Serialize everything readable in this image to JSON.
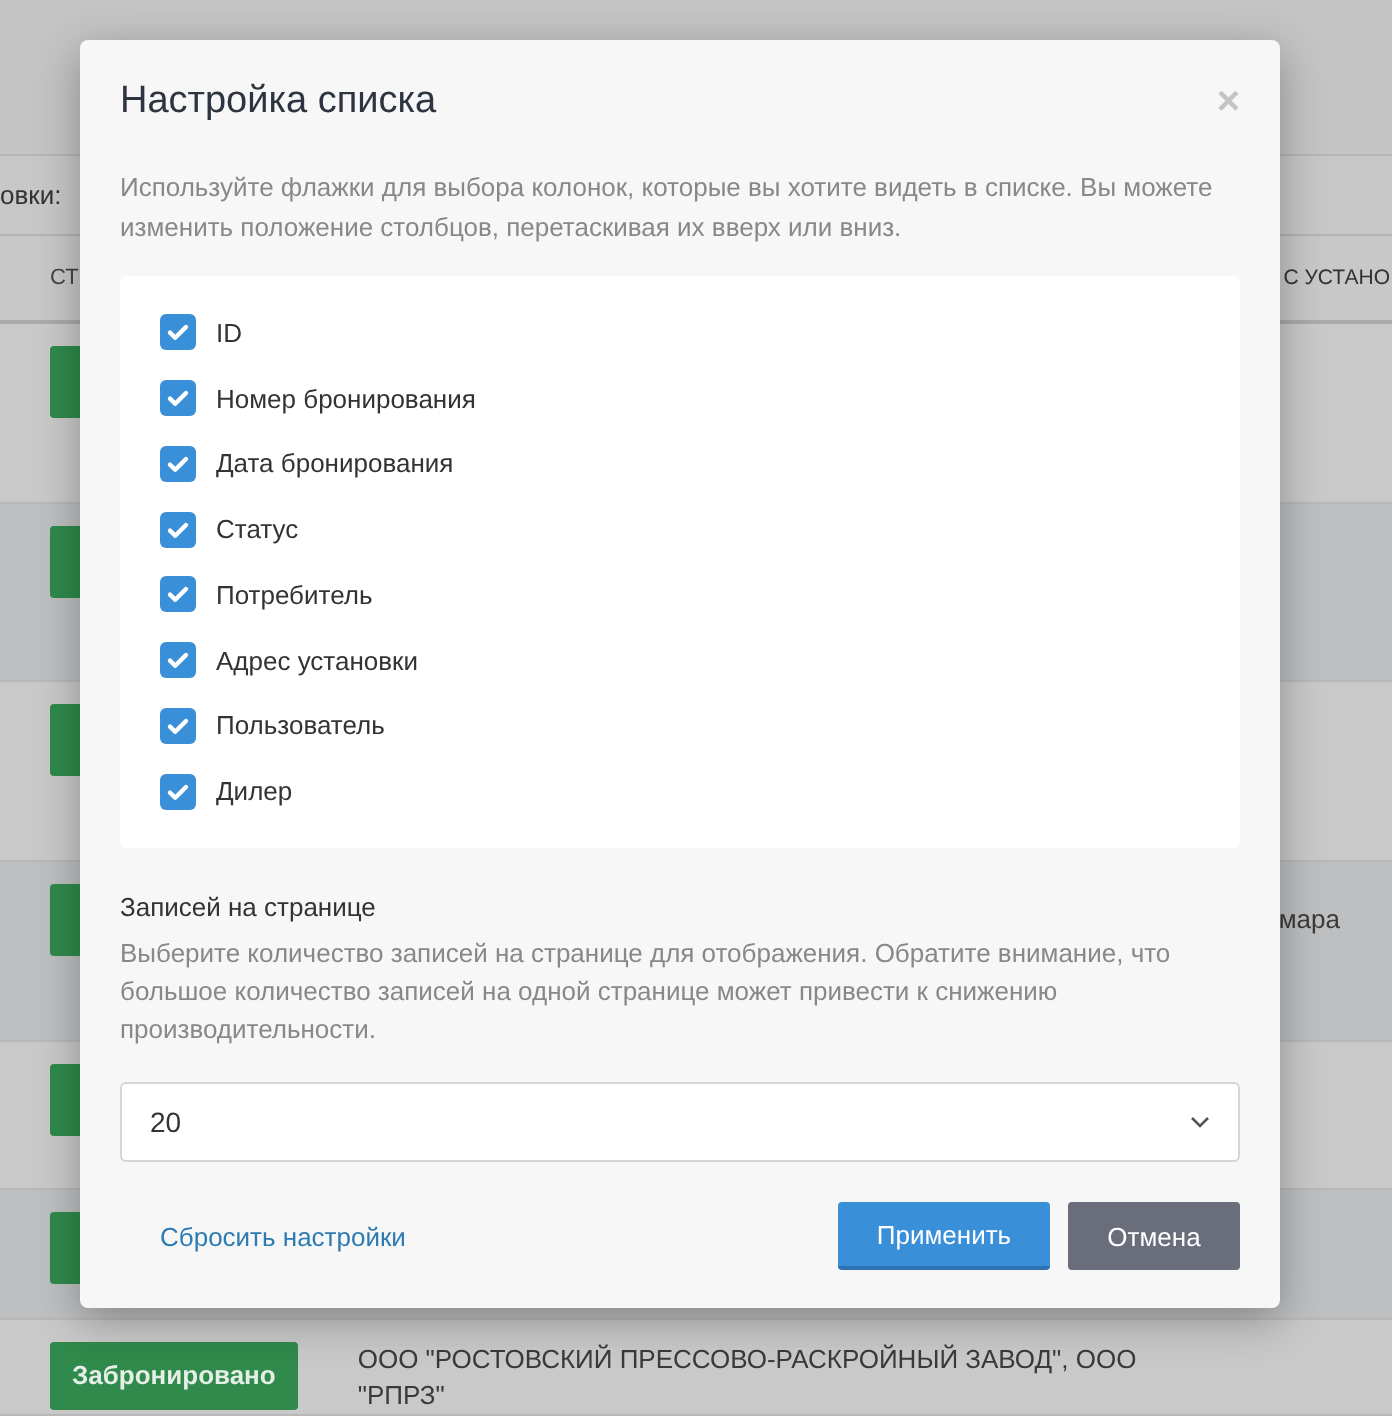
{
  "background": {
    "filter_label": "овки:",
    "columns": [
      {
        "label": "СТ"
      },
      {
        "label": "С УСТАНО"
      }
    ],
    "rows": [
      {},
      {},
      {},
      {
        "address": "мара"
      },
      {},
      {},
      {
        "status": "Забронировано",
        "address": "ООО \"РОСТОВСКИЙ ПРЕССОВО-РАСКРОЙНЫЙ ЗАВОД\", ООО \"РПРЗ\""
      }
    ]
  },
  "dialog": {
    "title": "Настройка списка",
    "close": "×",
    "description": "Используйте флажки для выбора колонок, которые вы хотите видеть в списке. Вы можете изменить положение столбцов, перетаскивая их вверх или вниз.",
    "columns": [
      {
        "label": "ID",
        "checked": true
      },
      {
        "label": "Номер бронирования",
        "checked": true
      },
      {
        "label": "Дата бронирования",
        "checked": true
      },
      {
        "label": "Статус",
        "checked": true
      },
      {
        "label": "Потребитель",
        "checked": true
      },
      {
        "label": "Адрес установки",
        "checked": true
      },
      {
        "label": "Пользователь",
        "checked": true
      },
      {
        "label": "Дилер",
        "checked": true
      }
    ],
    "per_page": {
      "title": "Записей на странице",
      "description": "Выберите количество записей на странице для отображения. Обратите внимание, что большое количество записей на одной странице может привести к снижению производительности.",
      "value": "20"
    },
    "reset_link": "Сбросить настройки",
    "buttons": [
      {
        "label": "Применить",
        "kind": "primary"
      },
      {
        "label": "Отмена",
        "kind": "secondary"
      }
    ]
  }
}
